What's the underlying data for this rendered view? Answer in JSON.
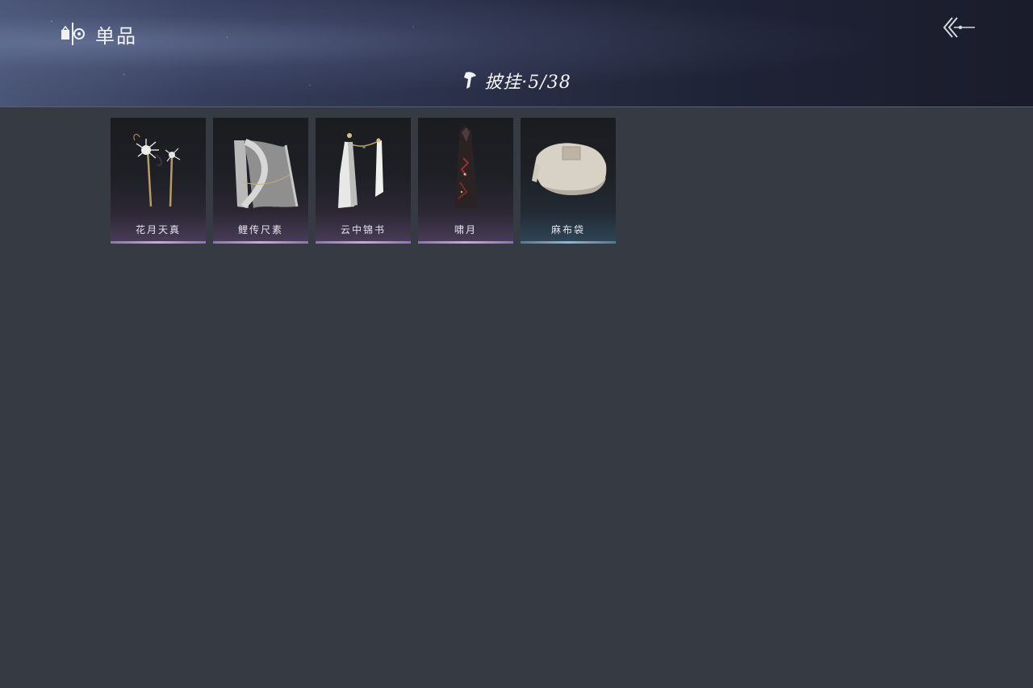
{
  "header": {
    "title": "单品",
    "title_icon": "single-item-icon",
    "back_icon": "back-arrow-icon"
  },
  "category": {
    "icon": "cape-icon",
    "label": "披挂·5/38"
  },
  "items": [
    {
      "name": "花月天真",
      "art": "flower-hairpin-icon",
      "quality_color": "#c6a8e6"
    },
    {
      "name": "鲤传尺素",
      "art": "silk-drape-icon",
      "quality_color": "#c6a8e6"
    },
    {
      "name": "云中锦书",
      "art": "white-banner-icon",
      "quality_color": "#c6a8e6"
    },
    {
      "name": "啸月",
      "art": "dark-cape-icon",
      "quality_color": "#c6a8e6"
    },
    {
      "name": "麻布袋",
      "art": "burlap-sack-icon",
      "quality_color": "#8fb5d6"
    }
  ]
}
